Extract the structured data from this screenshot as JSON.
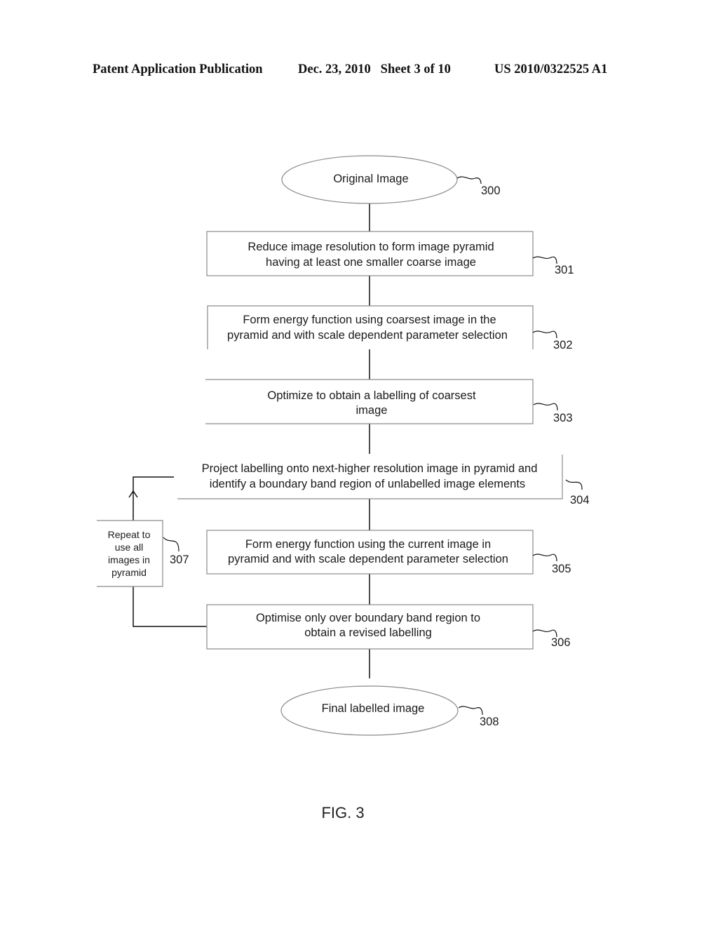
{
  "header": {
    "publication": "Patent Application Publication",
    "date_sheet": "Dec. 23, 2010   Sheet 3 of 10",
    "patent_number": "US 2010/0322525 A1"
  },
  "flowchart": {
    "start": {
      "text": "Original Image",
      "ref": "300"
    },
    "steps": [
      {
        "ref": "301",
        "lines": [
          "Reduce image resolution to form image pyramid",
          "having at least one smaller coarse image"
        ]
      },
      {
        "ref": "302",
        "lines": [
          "Form energy function using coarsest image in the",
          "pyramid and with scale dependent parameter selection"
        ]
      },
      {
        "ref": "303",
        "lines": [
          "Optimize to obtain a labelling of coarsest",
          "image"
        ]
      },
      {
        "ref": "304",
        "lines": [
          "Project labelling onto next-higher resolution image in pyramid and",
          "identify a boundary band region of unlabelled image elements"
        ]
      },
      {
        "ref": "305",
        "lines": [
          "Form energy function using the current image in",
          "pyramid and with scale dependent parameter selection"
        ]
      },
      {
        "ref": "306",
        "lines": [
          "Optimise only over boundary band region to",
          "obtain a revised labelling"
        ]
      }
    ],
    "loop": {
      "ref": "307",
      "lines": [
        "Repeat to",
        "use all",
        "images in",
        "pyramid"
      ]
    },
    "end": {
      "text": "Final labelled image",
      "ref": "308"
    }
  },
  "figure_label": "FIG. 3"
}
